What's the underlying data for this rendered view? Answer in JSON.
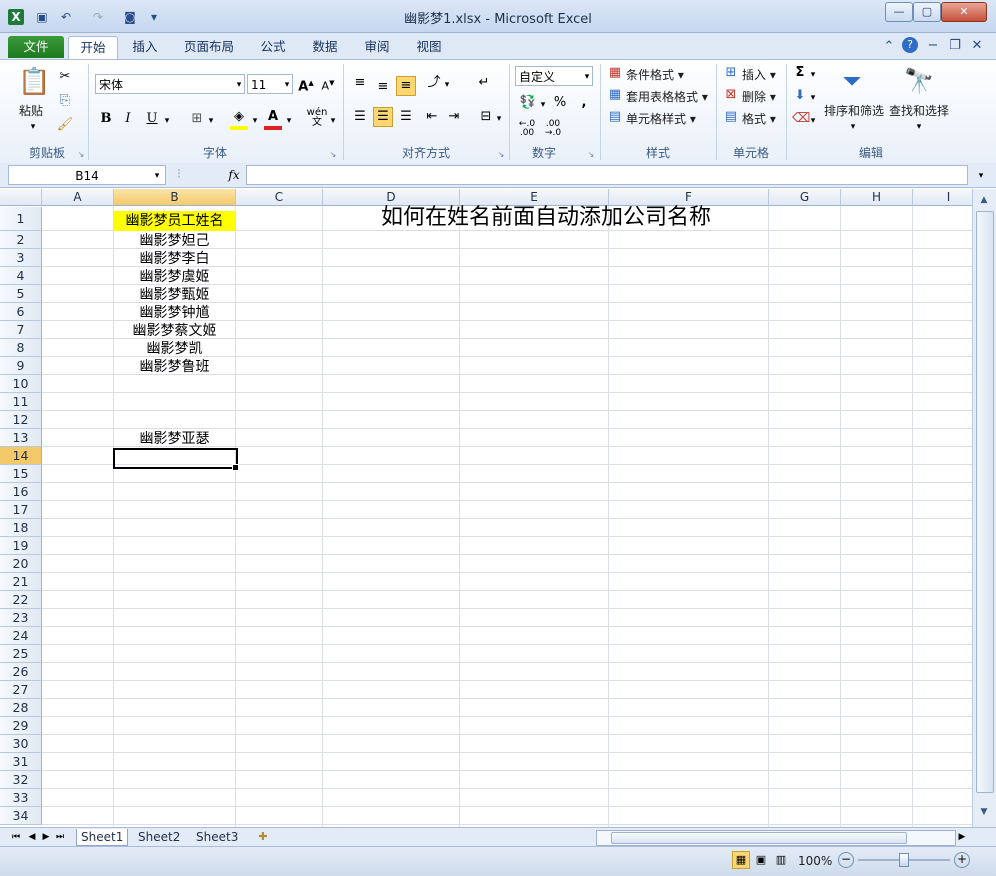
{
  "window": {
    "title": "幽影梦1.xlsx - Microsoft Excel"
  },
  "ribbon_tabs": [
    "文件",
    "开始",
    "插入",
    "页面布局",
    "公式",
    "数据",
    "审阅",
    "视图"
  ],
  "ribbon": {
    "clipboard": {
      "paste": "粘贴",
      "group": "剪贴板"
    },
    "font": {
      "name": "宋体",
      "size": "11",
      "group": "字体",
      "bold": "B",
      "italic": "I",
      "underline": "U",
      "phonetic": "wén"
    },
    "alignment": {
      "group": "对齐方式"
    },
    "number": {
      "format": "自定义",
      "group": "数字",
      "percent": "%",
      "comma": ",",
      "dec_inc": ".0 .00",
      "dec_dec": ".00 .0"
    },
    "styles": {
      "conditional": "条件格式",
      "table": "套用表格格式",
      "cell": "单元格样式",
      "group": "样式"
    },
    "cells": {
      "insert": "插入",
      "delete": "删除",
      "format": "格式",
      "group": "单元格"
    },
    "editing": {
      "sigma": "Σ",
      "sort": "排序和筛选",
      "find": "查找和选择",
      "group": "编辑"
    }
  },
  "formula_bar": {
    "name_box": "B14",
    "fx": "fx",
    "formula": ""
  },
  "columns": [
    "A",
    "B",
    "C",
    "D",
    "E",
    "F",
    "G",
    "H",
    "I"
  ],
  "rows": [
    "1",
    "2",
    "3",
    "4",
    "5",
    "6",
    "7",
    "8",
    "9",
    "10",
    "11",
    "12",
    "13",
    "14",
    "15",
    "16",
    "17",
    "18",
    "19",
    "20",
    "21",
    "22",
    "23",
    "24",
    "25",
    "26",
    "27",
    "28",
    "29",
    "30",
    "31",
    "32",
    "33",
    "34"
  ],
  "cells": {
    "B1": "幽影梦员工姓名",
    "B2": "幽影梦妲己",
    "B3": "幽影梦李白",
    "B4": "幽影梦虞姬",
    "B5": "幽影梦甄姬",
    "B6": "幽影梦钟馗",
    "B7": "幽影梦蔡文姬",
    "B8": "幽影梦凯",
    "B9": "幽影梦鲁班",
    "B13": "幽影梦亚瑟",
    "D1": "如何在姓名前面自动添加公司名称"
  },
  "selected_cell": "B14",
  "sheets": [
    "Sheet1",
    "Sheet2",
    "Sheet3"
  ],
  "status": {
    "zoom": "100%"
  },
  "colors": {
    "highlight": "#ffff00",
    "header_selected": "#f4c96a",
    "file_tab": "#2a8a2a"
  }
}
